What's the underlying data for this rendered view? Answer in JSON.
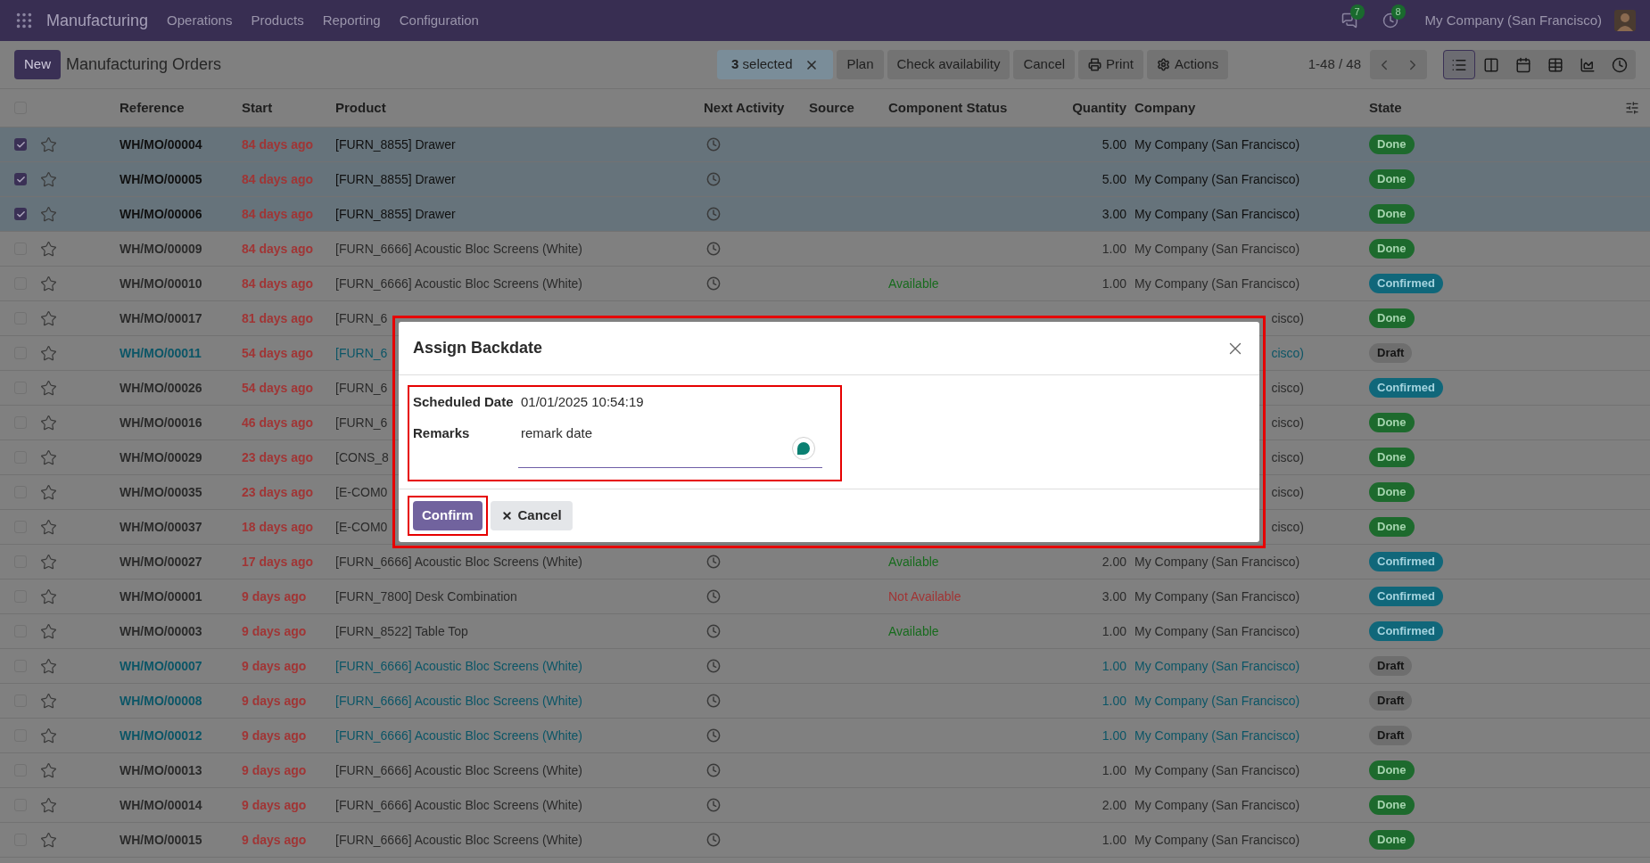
{
  "navbar": {
    "app": "Manufacturing",
    "menus": [
      "Operations",
      "Products",
      "Reporting",
      "Configuration"
    ],
    "chat_count": "7",
    "activity_count": "8",
    "company": "My Company (San Francisco)"
  },
  "control_panel": {
    "new_button": "New",
    "title": "Manufacturing Orders",
    "selection": "**3** selected",
    "actions": [
      {
        "label": "Plan",
        "kind": "plain"
      },
      {
        "label": "Check availability",
        "kind": "plain"
      },
      {
        "label": "Cancel",
        "kind": "plain"
      },
      {
        "label": "Print",
        "kind": "print"
      },
      {
        "label": "Actions",
        "kind": "menu"
      }
    ],
    "pager": "1-48 / 48",
    "views": [
      {
        "kind": "list",
        "selected": true
      },
      {
        "kind": "kanban",
        "selected": false
      },
      {
        "kind": "calendar",
        "selected": false
      },
      {
        "kind": "pivot",
        "selected": false
      },
      {
        "kind": "graph",
        "selected": false
      },
      {
        "kind": "activity",
        "selected": false
      }
    ]
  },
  "table": {
    "all_selected": false,
    "columns": [
      "Reference",
      "Start",
      "Product",
      "Next Activity",
      "Source",
      "Component Status",
      "Quantity",
      "Company",
      "State"
    ],
    "rows": [
      {
        "selected": true,
        "covered": false,
        "reference": "WH/MO/00004",
        "start": "84 days ago",
        "product": "[FURN_8855] Drawer",
        "quantity": "5.00",
        "company": "My Company (San Francisco)",
        "state": {
          "label": "Done",
          "kind": "done"
        }
      },
      {
        "selected": true,
        "covered": false,
        "reference": "WH/MO/00005",
        "start": "84 days ago",
        "product": "[FURN_8855] Drawer",
        "quantity": "5.00",
        "company": "My Company (San Francisco)",
        "state": {
          "label": "Done",
          "kind": "done"
        }
      },
      {
        "selected": true,
        "covered": false,
        "reference": "WH/MO/00006",
        "start": "84 days ago",
        "product": "[FURN_8855] Drawer",
        "quantity": "3.00",
        "company": "My Company (San Francisco)",
        "state": {
          "label": "Done",
          "kind": "done"
        }
      },
      {
        "selected": false,
        "covered": false,
        "reference": "WH/MO/00009",
        "start": "84 days ago",
        "product": "[FURN_6666] Acoustic Bloc Screens (White)",
        "quantity": "1.00",
        "company": "My Company (San Francisco)",
        "state": {
          "label": "Done",
          "kind": "done"
        }
      },
      {
        "selected": false,
        "covered": false,
        "reference": "WH/MO/00010",
        "start": "84 days ago",
        "product": "[FURN_6666] Acoustic Bloc Screens (White)",
        "component_status": {
          "text": "Available",
          "kind": "available"
        },
        "quantity": "1.00",
        "company": "My Company (San Francisco)",
        "state": {
          "label": "Confirmed",
          "kind": "confirmed"
        }
      },
      {
        "selected": false,
        "covered": true,
        "reference": "WH/MO/00017",
        "start": "81 days ago",
        "product": "[FURN_6",
        "company": "cisco)",
        "state": {
          "label": "Done",
          "kind": "done"
        }
      },
      {
        "selected": false,
        "covered": true,
        "reference": "WH/MO/00011",
        "start": "54 days ago",
        "product": "[FURN_6",
        "company": "cisco)",
        "state": {
          "label": "Draft",
          "kind": "draft"
        }
      },
      {
        "selected": false,
        "covered": true,
        "reference": "WH/MO/00026",
        "start": "54 days ago",
        "product": "[FURN_6",
        "company": "cisco)",
        "state": {
          "label": "Confirmed",
          "kind": "confirmed"
        }
      },
      {
        "selected": false,
        "covered": true,
        "reference": "WH/MO/00016",
        "start": "46 days ago",
        "product": "[FURN_6",
        "company": "cisco)",
        "state": {
          "label": "Done",
          "kind": "done"
        }
      },
      {
        "selected": false,
        "covered": true,
        "reference": "WH/MO/00029",
        "start": "23 days ago",
        "product": "[CONS_8",
        "company": "cisco)",
        "state": {
          "label": "Done",
          "kind": "done"
        }
      },
      {
        "selected": false,
        "covered": true,
        "reference": "WH/MO/00035",
        "start": "23 days ago",
        "product": "[E-COM0",
        "company": "cisco)",
        "state": {
          "label": "Done",
          "kind": "done"
        }
      },
      {
        "selected": false,
        "covered": true,
        "reference": "WH/MO/00037",
        "start": "18 days ago",
        "product": "[E-COM0",
        "company": "cisco)",
        "state": {
          "label": "Done",
          "kind": "done"
        }
      },
      {
        "selected": false,
        "covered": false,
        "reference": "WH/MO/00027",
        "start": "17 days ago",
        "product": "[FURN_6666] Acoustic Bloc Screens (White)",
        "component_status": {
          "text": "Available",
          "kind": "available"
        },
        "quantity": "2.00",
        "company": "My Company (San Francisco)",
        "state": {
          "label": "Confirmed",
          "kind": "confirmed"
        }
      },
      {
        "selected": false,
        "covered": false,
        "reference": "WH/MO/00001",
        "start": "9 days ago",
        "product": "[FURN_7800] Desk Combination",
        "component_status": {
          "text": "Not Available",
          "kind": "unavailable"
        },
        "quantity": "3.00",
        "company": "My Company (San Francisco)",
        "state": {
          "label": "Confirmed",
          "kind": "confirmed"
        }
      },
      {
        "selected": false,
        "covered": false,
        "reference": "WH/MO/00003",
        "start": "9 days ago",
        "product": "[FURN_8522] Table Top",
        "component_status": {
          "text": "Available",
          "kind": "available"
        },
        "quantity": "1.00",
        "company": "My Company (San Francisco)",
        "state": {
          "label": "Confirmed",
          "kind": "confirmed"
        }
      },
      {
        "selected": false,
        "covered": false,
        "reference": "WH/MO/00007",
        "start": "9 days ago",
        "product": "[FURN_6666] Acoustic Bloc Screens (White)",
        "quantity": "1.00",
        "company": "My Company (San Francisco)",
        "state": {
          "label": "Draft",
          "kind": "draft"
        }
      },
      {
        "selected": false,
        "covered": false,
        "reference": "WH/MO/00008",
        "start": "9 days ago",
        "product": "[FURN_6666] Acoustic Bloc Screens (White)",
        "quantity": "1.00",
        "company": "My Company (San Francisco)",
        "state": {
          "label": "Draft",
          "kind": "draft"
        }
      },
      {
        "selected": false,
        "covered": false,
        "reference": "WH/MO/00012",
        "start": "9 days ago",
        "product": "[FURN_6666] Acoustic Bloc Screens (White)",
        "quantity": "1.00",
        "company": "My Company (San Francisco)",
        "state": {
          "label": "Draft",
          "kind": "draft"
        }
      },
      {
        "selected": false,
        "covered": false,
        "reference": "WH/MO/00013",
        "start": "9 days ago",
        "product": "[FURN_6666] Acoustic Bloc Screens (White)",
        "quantity": "1.00",
        "company": "My Company (San Francisco)",
        "state": {
          "label": "Done",
          "kind": "done"
        }
      },
      {
        "selected": false,
        "covered": false,
        "reference": "WH/MO/00014",
        "start": "9 days ago",
        "product": "[FURN_6666] Acoustic Bloc Screens (White)",
        "quantity": "2.00",
        "company": "My Company (San Francisco)",
        "state": {
          "label": "Done",
          "kind": "done"
        }
      },
      {
        "selected": false,
        "covered": false,
        "reference": "WH/MO/00015",
        "start": "9 days ago",
        "product": "[FURN_6666] Acoustic Bloc Screens (White)",
        "quantity": "1.00",
        "company": "My Company (San Francisco)",
        "state": {
          "label": "Done",
          "kind": "done"
        }
      }
    ]
  },
  "dialog": {
    "title": "Assign Backdate",
    "fields": [
      {
        "label": "Scheduled Date",
        "value": "01/01/2025 10:54:19",
        "kind": "date"
      },
      {
        "label": "Remarks",
        "value": "remark date",
        "kind": "text"
      }
    ],
    "buttons": [
      {
        "label": "Confirm",
        "kind": "primary"
      },
      {
        "label": "Cancel",
        "kind": "secondary"
      }
    ]
  }
}
